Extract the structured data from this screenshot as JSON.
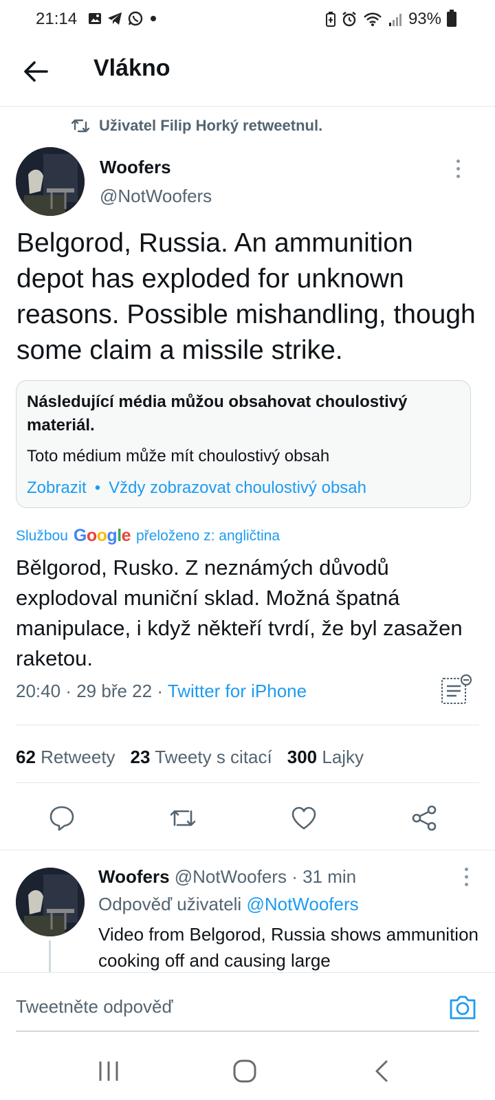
{
  "status_bar": {
    "time": "21:14",
    "notification_icons": [
      "gallery-icon",
      "telegram-icon",
      "whatsapp-icon",
      "dot-icon"
    ],
    "system_icons": [
      "battery-saver-icon",
      "alarm-icon",
      "wifi-icon",
      "signal-icon"
    ],
    "battery": "93%"
  },
  "header": {
    "title": "Vlákno"
  },
  "retweet": {
    "label": "Uživatel Filip Horký retweetnul."
  },
  "tweet": {
    "author_name": "Woofers",
    "author_handle": "@NotWoofers",
    "text": "Belgorod, Russia. An ammunition depot has exploded for unknown reasons. Possible mishandling, though some claim a missile strike.",
    "sensitive": {
      "title": "Následující média můžou obsahovat choulostivý materiál.",
      "subtitle": "Toto médium může mít choulostivý obsah",
      "show_label": "Zobrazit",
      "separator": "•",
      "always_show_label": "Vždy zobrazovat choulostivý obsah"
    },
    "translation": {
      "prefix": "Službou",
      "brand": "Google",
      "suffix": "přeloženo z: angličtina",
      "text": "Bělgorod, Rusko. Z neznámých důvodů explodoval muniční sklad. Možná špatná manipulace, i když někteří tvrdí, že byl zasažen raketou."
    },
    "time": "20:40",
    "date": "29 bře 22",
    "meta_separator": "·",
    "source": "Twitter for iPhone",
    "stats": {
      "retweets_count": "62",
      "retweets_label": "Retweety",
      "quotes_count": "23",
      "quotes_label": "Tweety s citací",
      "likes_count": "300",
      "likes_label": "Lajky"
    }
  },
  "reply": {
    "author_name": "Woofers",
    "author_handle": "@NotWoofers",
    "separator": "·",
    "time_ago": "31 min",
    "reply_to_prefix": "Odpověď uživateli",
    "reply_to_handle": "@NotWoofers",
    "text": "Video from Belgorod, Russia shows ammunition cooking off and causing large"
  },
  "compose": {
    "placeholder": "Tweetněte odpověď"
  },
  "colors": {
    "accent": "#1d9bf0",
    "text_primary": "#0f1419",
    "text_secondary": "#536471",
    "divider": "#e3e7ea"
  }
}
